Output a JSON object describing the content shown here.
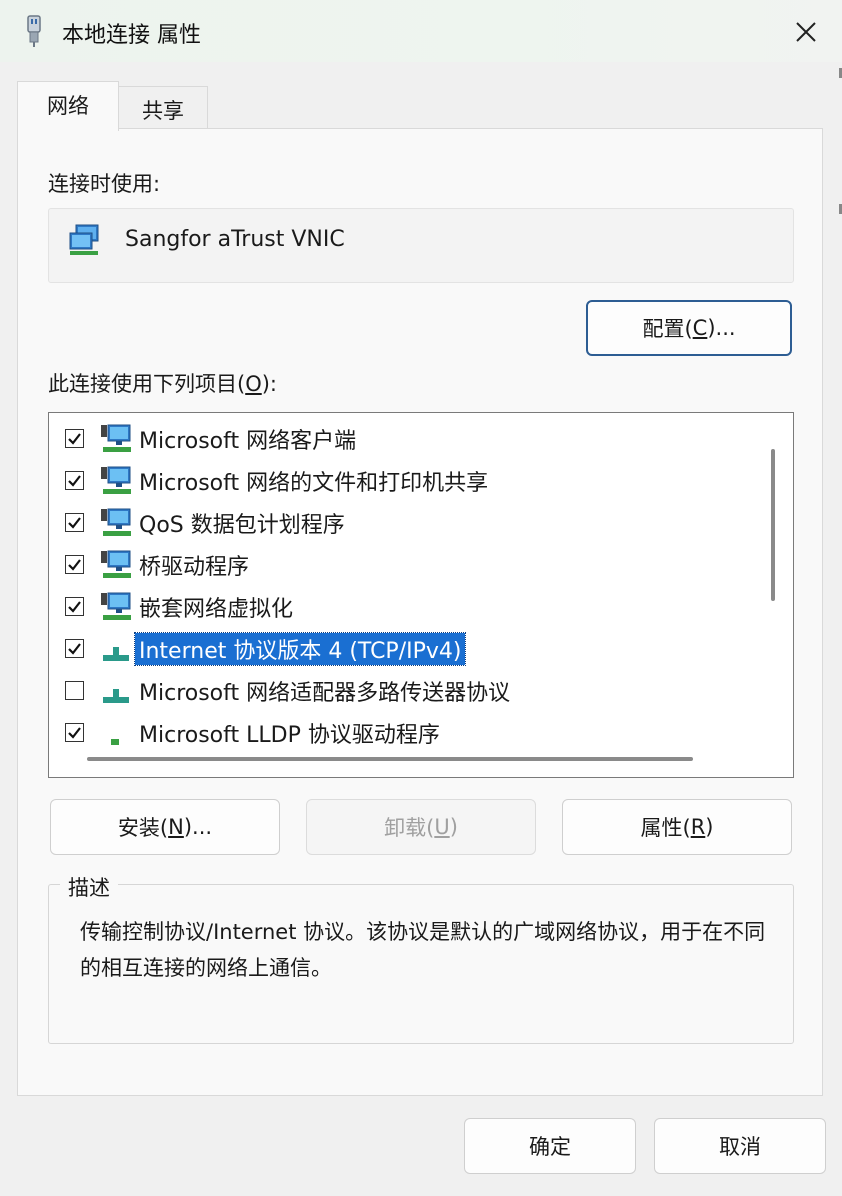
{
  "window": {
    "title": "本地连接 属性",
    "close_symbol": "✕"
  },
  "tabs": [
    {
      "label": "网络",
      "active": true
    },
    {
      "label": "共享",
      "active": false
    }
  ],
  "network": {
    "connect_using_label": "连接时使用:",
    "adapter_name": "Sangfor aTrust VNIC",
    "configure_button": {
      "text": "配置(",
      "key": "C",
      "suffix": ")..."
    },
    "items_label": {
      "text": "此连接使用下列项目(",
      "key": "O",
      "suffix": "):"
    },
    "items": [
      {
        "label": "Microsoft 网络客户端",
        "checked": true,
        "icon": "network-client-icon",
        "selected": false
      },
      {
        "label": "Microsoft 网络的文件和打印机共享",
        "checked": true,
        "icon": "network-client-icon",
        "selected": false
      },
      {
        "label": "QoS 数据包计划程序",
        "checked": true,
        "icon": "network-client-icon",
        "selected": false
      },
      {
        "label": "桥驱动程序",
        "checked": true,
        "icon": "network-client-icon",
        "selected": false
      },
      {
        "label": "嵌套网络虚拟化",
        "checked": true,
        "icon": "network-client-icon",
        "selected": false
      },
      {
        "label": "Internet 协议版本 4 (TCP/IPv4)",
        "checked": true,
        "icon": "protocol-icon",
        "selected": true
      },
      {
        "label": "Microsoft 网络适配器多路传送器协议",
        "checked": false,
        "icon": "protocol-icon",
        "selected": false
      },
      {
        "label": "Microsoft LLDP 协议驱动程序",
        "checked": true,
        "icon": "protocol-icon",
        "selected": false
      }
    ],
    "install_button": {
      "text": "安装(",
      "key": "N",
      "suffix": ")..."
    },
    "uninstall_button": {
      "text": "卸载(",
      "key": "U",
      "suffix": ")"
    },
    "properties_button": {
      "text": "属性(",
      "key": "R",
      "suffix": ")"
    },
    "description_title": "描述",
    "description_text": "传输控制协议/Internet 协议。该协议是默认的广域网络协议，用于在不同的相互连接的网络上通信。"
  },
  "footer": {
    "ok_label": "确定",
    "cancel_label": "取消"
  },
  "colors": {
    "selection": "#1a6fd2",
    "primary_border": "#2d5d93"
  }
}
